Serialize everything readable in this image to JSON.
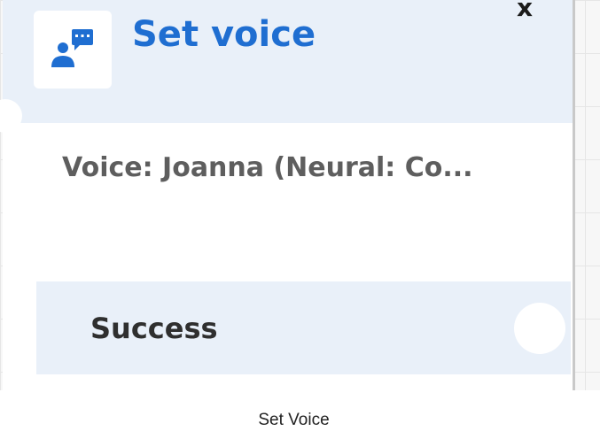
{
  "block": {
    "title": "Set voice",
    "close_label": "x",
    "icon": "voice-person-speech-icon",
    "detail": "Voice: Joanna (Neural: Co...",
    "branch": {
      "label": "Success"
    }
  },
  "caption": "Set Voice",
  "colors": {
    "accent": "#1f6ed1",
    "header_bg": "#e9f0f9",
    "detail_text": "#5e5e5e"
  }
}
